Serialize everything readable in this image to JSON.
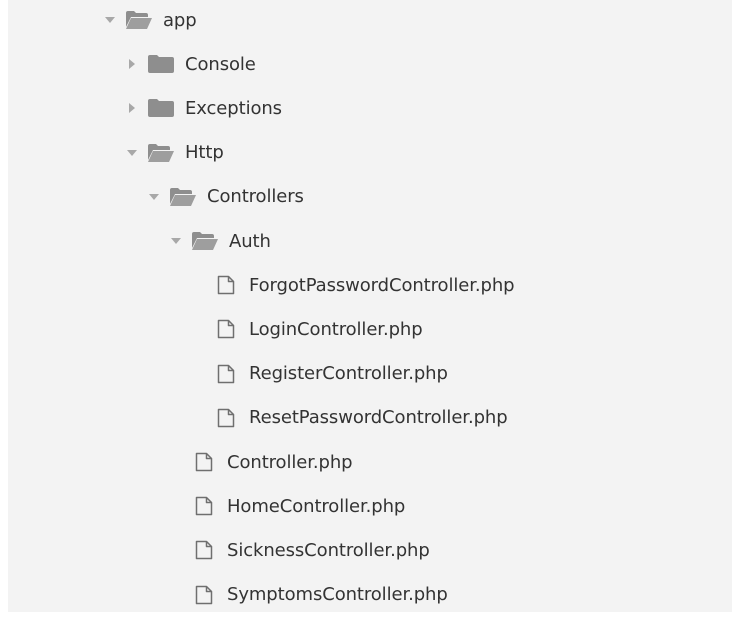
{
  "colors": {
    "panel": "#f3f3f3",
    "text": "#333333",
    "folder_open": "#8e8e8e",
    "folder_closed": "#8e8e8e",
    "arrow": "#a8a8a8",
    "file_outline": "#6f6f6f"
  },
  "tree": [
    {
      "label": "app",
      "depth": 0,
      "kind": "folder",
      "expanded": true,
      "icon": "folder-open-icon"
    },
    {
      "label": "Console",
      "depth": 1,
      "kind": "folder",
      "expanded": false,
      "icon": "folder-icon"
    },
    {
      "label": "Exceptions",
      "depth": 1,
      "kind": "folder",
      "expanded": false,
      "icon": "folder-icon"
    },
    {
      "label": "Http",
      "depth": 1,
      "kind": "folder",
      "expanded": true,
      "icon": "folder-open-icon"
    },
    {
      "label": "Controllers",
      "depth": 2,
      "kind": "folder",
      "expanded": true,
      "icon": "folder-open-icon"
    },
    {
      "label": "Auth",
      "depth": 3,
      "kind": "folder",
      "expanded": true,
      "icon": "folder-open-icon"
    },
    {
      "label": "ForgotPasswordController.php",
      "depth": 4,
      "kind": "file",
      "icon": "file-icon"
    },
    {
      "label": "LoginController.php",
      "depth": 4,
      "kind": "file",
      "icon": "file-icon"
    },
    {
      "label": "RegisterController.php",
      "depth": 4,
      "kind": "file",
      "icon": "file-icon"
    },
    {
      "label": "ResetPasswordController.php",
      "depth": 4,
      "kind": "file",
      "icon": "file-icon"
    },
    {
      "label": "Controller.php",
      "depth": 3,
      "kind": "file",
      "icon": "file-icon"
    },
    {
      "label": "HomeController.php",
      "depth": 3,
      "kind": "file",
      "icon": "file-icon"
    },
    {
      "label": "SicknessController.php",
      "depth": 3,
      "kind": "file",
      "icon": "file-icon"
    },
    {
      "label": "SymptomsController.php",
      "depth": 3,
      "kind": "file",
      "icon": "file-icon"
    }
  ]
}
